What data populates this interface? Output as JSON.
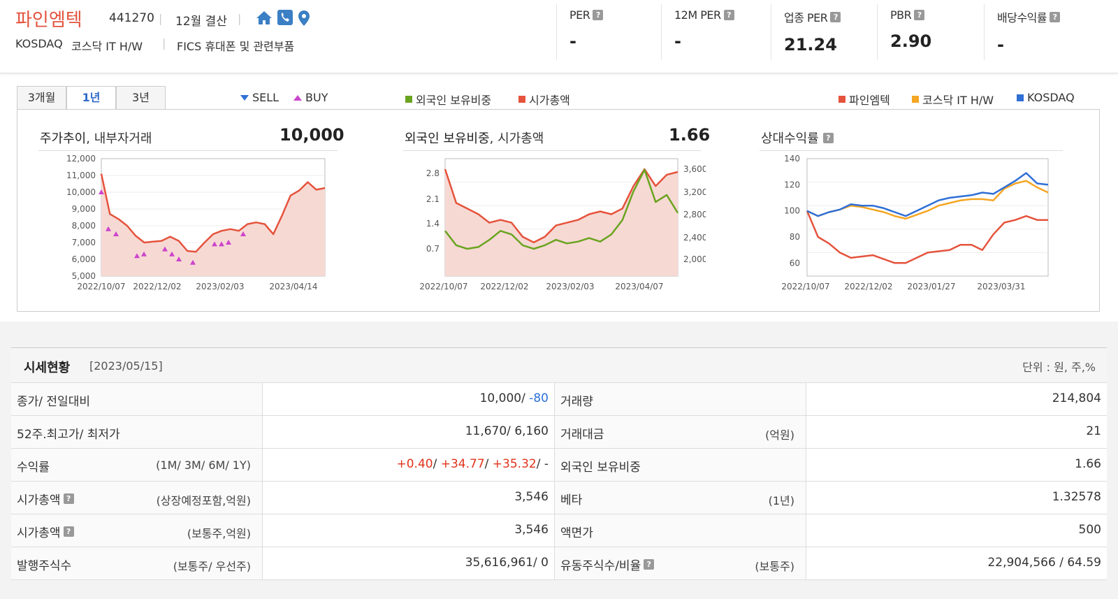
{
  "company": {
    "name": "파인엠텍",
    "code": "441270",
    "fiscal": "12월 결산",
    "market": "KOSDAQ",
    "industry": "코스닥 IT H/W",
    "fics": "FICS 휴대폰 및 관련부품"
  },
  "icons": [
    "home-icon",
    "phone-icon",
    "location-pin-icon"
  ],
  "metrics": [
    {
      "label": "PER",
      "value": "-"
    },
    {
      "label": "12M PER",
      "value": "-"
    },
    {
      "label": "업종 PER",
      "value": "21.24"
    },
    {
      "label": "PBR",
      "value": "2.90"
    },
    {
      "label": "배당수익률",
      "value": "-"
    }
  ],
  "tabs": [
    "3개월",
    "1년",
    "3년"
  ],
  "active_tab": "1년",
  "legend": {
    "sell": "SELL",
    "buy": "BUY",
    "foreign": "외국인 보유비중",
    "mcap": "시가총액",
    "stock": "파인엠텍",
    "kosdaq_it": "코스닥 IT H/W",
    "kosdaq": "KOSDAQ"
  },
  "colors": {
    "brand": "#e2533e",
    "red_series": "#e5533c",
    "green_series": "#6aa420",
    "orange_series": "#f5a623",
    "blue_series": "#2f6fd6",
    "buy": "#cc44cc",
    "sell": "#2f6fd6",
    "fill": "#f7d9d4"
  },
  "charts": {
    "price": {
      "title": "주가추이",
      "subtitle": ", 내부자거래",
      "value": "10,000"
    },
    "foreign": {
      "title": "외국인 보유비중",
      "subtitle": ", 시가총액",
      "value": "1.66"
    },
    "relative": {
      "title": "상대수익률"
    }
  },
  "chart_data": [
    {
      "type": "area",
      "title": "주가추이, 내부자거래",
      "x": [
        "2022/10/07",
        "2022/12/02",
        "2023/02/03",
        "2023/04/14"
      ],
      "ylim": [
        5000,
        12000
      ],
      "yticks": [
        "12,000",
        "11,000",
        "10,000",
        "9,000",
        "8,000",
        "7,000",
        "6,000",
        "5,000"
      ],
      "series": [
        {
          "name": "파인엠텍",
          "values": [
            11100,
            8700,
            8400,
            8000,
            7400,
            7000,
            7050,
            7100,
            7350,
            7100,
            6500,
            6450,
            7000,
            7500,
            7700,
            7800,
            7700,
            8100,
            8200,
            8100,
            7500,
            8600,
            9800,
            10100,
            10600,
            10150,
            10250
          ]
        }
      ],
      "buy_points": [
        10000,
        7800,
        7500,
        6200,
        6300,
        6600,
        6300,
        6000,
        5800,
        6900,
        6900,
        7000,
        7500
      ]
    },
    {
      "type": "line",
      "title": "외국인 보유비중, 시가총액",
      "x": [
        "2022/10/07",
        "2022/12/02",
        "2023/02/03",
        "2023/04/07"
      ],
      "ylim_left": [
        0,
        3.5
      ],
      "yticks_left": [
        "2.8",
        "2.1",
        "1.4",
        "0.7"
      ],
      "yticks_right": [
        "3,600",
        "3,200",
        "2,800",
        "2,400",
        "2,000"
      ],
      "series": [
        {
          "name": "외국인 보유비중",
          "values": [
            1.2,
            0.8,
            0.7,
            0.75,
            0.95,
            1.2,
            1.1,
            0.8,
            0.7,
            0.8,
            0.95,
            0.85,
            0.9,
            1.0,
            0.9,
            1.1,
            1.5,
            2.3,
            2.9,
            2.0,
            2.2,
            1.7
          ]
        },
        {
          "name": "시가총액",
          "values": [
            3600,
            3000,
            2900,
            2800,
            2650,
            2700,
            2650,
            2400,
            2300,
            2400,
            2600,
            2650,
            2700,
            2800,
            2850,
            2800,
            2900,
            3300,
            3600,
            3300,
            3500,
            3550
          ]
        }
      ]
    },
    {
      "type": "line",
      "title": "상대수익률",
      "x": [
        "2022/10/07",
        "2022/12/02",
        "2023/01/27",
        "2023/03/31"
      ],
      "ylim": [
        50,
        140
      ],
      "yticks": [
        "140",
        "120",
        "100",
        "80",
        "60"
      ],
      "series": [
        {
          "name": "파인엠텍",
          "values": [
            100,
            80,
            75,
            68,
            64,
            65,
            66,
            63,
            60,
            60,
            64,
            68,
            69,
            70,
            74,
            74,
            70,
            82,
            91,
            93,
            96,
            93,
            93
          ]
        },
        {
          "name": "코스닥 IT H/W",
          "values": [
            100,
            96,
            99,
            101,
            104,
            103,
            101,
            99,
            96,
            94,
            97,
            100,
            104,
            106,
            108,
            109,
            109,
            108,
            117,
            121,
            123,
            118,
            114
          ]
        },
        {
          "name": "KOSDAQ",
          "values": [
            100,
            96,
            99,
            101,
            105,
            104,
            104,
            102,
            99,
            96,
            100,
            104,
            108,
            110,
            111,
            112,
            114,
            113,
            118,
            123,
            129,
            121,
            120
          ]
        }
      ]
    }
  ],
  "table": {
    "title": "시세현황",
    "date": "[2023/05/15]",
    "unit": "단위 : 원, 주,%",
    "rows": [
      {
        "l1": "종가/ 전일대비",
        "s1": "",
        "v1a": "10,000/ ",
        "v1b": "-80",
        "l2": "거래량",
        "s2": "",
        "v2": "214,804"
      },
      {
        "l1": "52주.최고가/ 최저가",
        "s1": "",
        "v1a": "11,670/ 6,160",
        "v1b": "",
        "l2": "거래대금",
        "s2": "(억원)",
        "v2": "21"
      },
      {
        "l1": "수익률",
        "s1": "(1M/ 3M/ 6M/ 1Y)",
        "v1a": "+0.40/ +34.77/ +35.32/ -",
        "v1b": "",
        "l2": "외국인 보유비중",
        "s2": "",
        "v2": "1.66"
      },
      {
        "l1": "시가총액",
        "s1": "(상장예정포함,억원)",
        "v1a": "3,546",
        "v1b": "",
        "l2": "베타",
        "s2": "(1년)",
        "v2": "1.32578"
      },
      {
        "l1": "시가총액",
        "s1": "(보통주,억원)",
        "v1a": "3,546",
        "v1b": "",
        "l2": "액면가",
        "s2": "",
        "v2": "500"
      },
      {
        "l1": "발행주식수",
        "s1": "(보통주/ 우선주)",
        "v1a": "35,616,961/ 0",
        "v1b": "",
        "l2": "유동주식수/비율",
        "s2": "(보통주)",
        "v2": "22,904,566 / 64.59"
      }
    ],
    "returns": [
      "+0.40",
      "+34.77",
      "+35.32",
      "-"
    ]
  }
}
